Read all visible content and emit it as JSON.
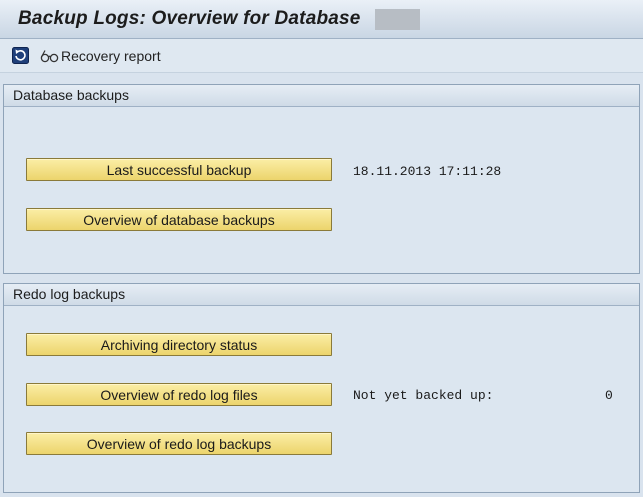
{
  "window": {
    "title": "Backup Logs: Overview for Database"
  },
  "toolbar": {
    "refresh_icon": "refresh-icon",
    "recovery_icon": "glasses-icon",
    "recovery_label": "Recovery report"
  },
  "database_backups": {
    "header": "Database backups",
    "last_successful_backup_label": "Last successful backup",
    "last_successful_backup_value": "18.11.2013 17:11:28",
    "overview_label": "Overview of database backups"
  },
  "redo_log_backups": {
    "header": "Redo log backups",
    "archiving_status_label": "Archiving directory status",
    "redo_files_label": "Overview of redo log files",
    "not_backed_up_label": "Not yet backed up:",
    "not_backed_up_value": "0",
    "redo_backups_label": "Overview of redo log backups"
  },
  "colors": {
    "button_fill": "#ecd46c",
    "background": "#d9e3ee"
  }
}
